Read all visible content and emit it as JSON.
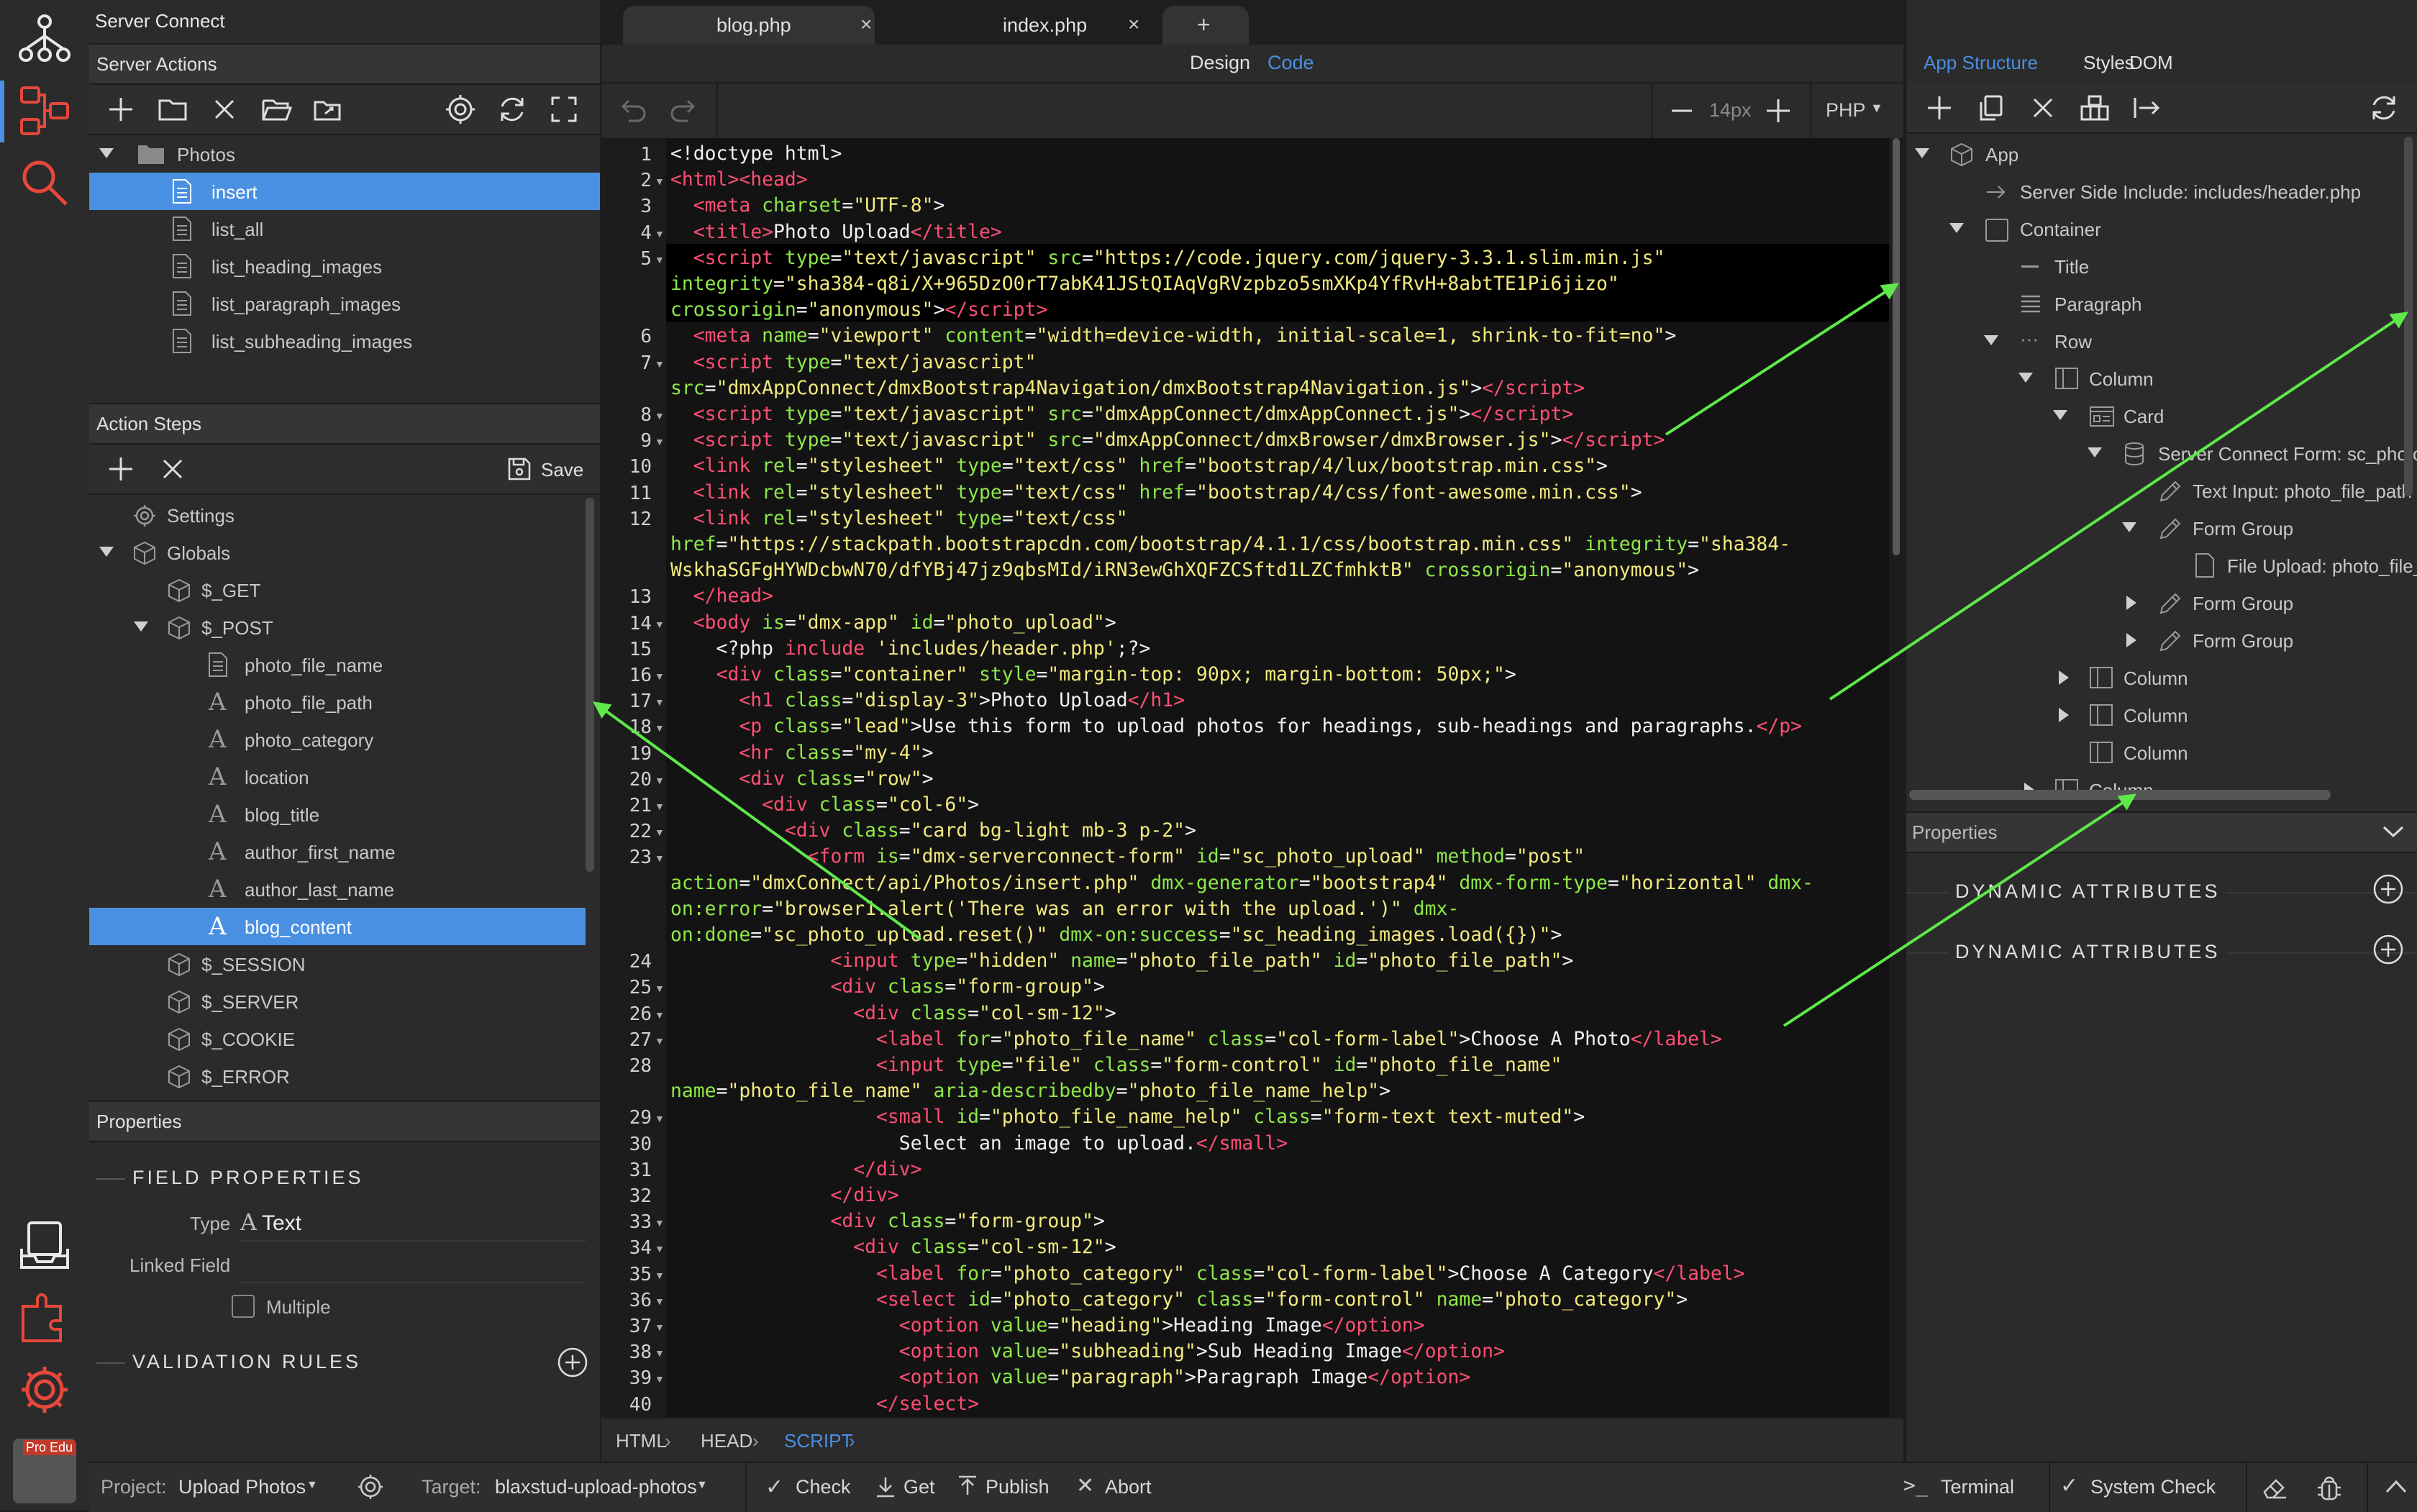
{
  "colors": {
    "accent": "#4a90e2",
    "tag": "#ff4f73",
    "attr": "#8ee84a",
    "string": "#f3e97e",
    "arrow": "#5ee84a"
  },
  "rail": {
    "badge": "Pro Edu"
  },
  "server_connect": {
    "title": "Server Connect",
    "actions_header": "Server Actions",
    "tree": [
      {
        "label": "Photos",
        "icon": "folder-icon"
      },
      {
        "label": "insert",
        "icon": "file-icon",
        "selected": true
      },
      {
        "label": "list_all",
        "icon": "file-icon"
      },
      {
        "label": "list_heading_images",
        "icon": "file-icon"
      },
      {
        "label": "list_paragraph_images",
        "icon": "file-icon"
      },
      {
        "label": "list_subheading_images",
        "icon": "file-icon"
      }
    ],
    "steps_header": "Action Steps",
    "save_label": "Save",
    "steps": [
      {
        "label": "Settings",
        "icon": "gear-icon"
      },
      {
        "label": "Globals",
        "icon": "cube-icon"
      },
      {
        "label": "$_GET",
        "icon": "cube-icon"
      },
      {
        "label": "$_POST",
        "icon": "cube-icon"
      },
      {
        "label": "photo_file_name",
        "icon": "file-icon"
      },
      {
        "label": "photo_file_path",
        "icon": "text-icon"
      },
      {
        "label": "photo_category",
        "icon": "text-icon"
      },
      {
        "label": "location",
        "icon": "text-icon"
      },
      {
        "label": "blog_title",
        "icon": "text-icon"
      },
      {
        "label": "author_first_name",
        "icon": "text-icon"
      },
      {
        "label": "author_last_name",
        "icon": "text-icon"
      },
      {
        "label": "blog_content",
        "icon": "text-icon",
        "selected": true
      },
      {
        "label": "$_SESSION",
        "icon": "cube-icon"
      },
      {
        "label": "$_SERVER",
        "icon": "cube-icon"
      },
      {
        "label": "$_COOKIE",
        "icon": "cube-icon"
      },
      {
        "label": "$_ERROR",
        "icon": "cube-icon"
      }
    ],
    "properties_header": "Properties",
    "field_properties": "FIELD PROPERTIES",
    "type_label": "Type",
    "type_value": "Text",
    "linked_field_label": "Linked Field",
    "multiple_label": "Multiple",
    "validation_rules": "VALIDATION RULES"
  },
  "editor": {
    "tabs": [
      {
        "label": "blog.php"
      },
      {
        "label": "index.php",
        "active": true
      }
    ],
    "mode_design": "Design",
    "mode_code": "Code",
    "font_size": "14px",
    "language": "PHP",
    "breadcrumb": [
      "HTML",
      "HEAD",
      "SCRIPT"
    ]
  },
  "code_lines": [
    {
      "n": "1",
      "html": "&lt;!doctype html&gt;"
    },
    {
      "n": "2",
      "fold": true,
      "html": "<span class=t>&lt;html&gt;</span><span class=t>&lt;head&gt;</span>"
    },
    {
      "n": "3",
      "html": "  <span class=t>&lt;meta</span> <span class=a>charset</span>=<span class=s>\"UTF-8\"</span>&gt;"
    },
    {
      "n": "4",
      "fold": true,
      "html": "  <span class=t>&lt;title&gt;</span>Photo Upload<span class=t>&lt;/title&gt;</span>"
    },
    {
      "n": "5",
      "fold": true,
      "html": "  <span class=t>&lt;script</span> <span class=a>type</span>=<span class=s>\"text/javascript\"</span> <span class=a>src</span>=<span class=s>\"https://code.jquery.com/jquery-3.3.1.slim.min.js\"</span>"
    },
    {
      "n": "",
      "html": "<span class=a>integrity</span>=<span class=s>\"sha384-q8i/X+965DzO0rT7abK41JStQIAqVgRVzpbzo5smXKp4YfRvH+8abtTE1Pi6jizo\"</span>"
    },
    {
      "n": "",
      "html": "<span class=a>crossorigin</span>=<span class=s>\"anonymous\"</span>&gt;<span class=t>&lt;/script&gt;</span>"
    },
    {
      "n": "6",
      "html": "  <span class=t>&lt;meta</span> <span class=a>name</span>=<span class=s>\"viewport\"</span> <span class=a>content</span>=<span class=s>\"width=device-width, initial-scale=1, shrink-to-fit=no\"</span>&gt;"
    },
    {
      "n": "7",
      "fold": true,
      "html": "  <span class=t>&lt;script</span> <span class=a>type</span>=<span class=s>\"text/javascript\"</span>"
    },
    {
      "n": "",
      "html": "<span class=a>src</span>=<span class=s>\"dmxAppConnect/dmxBootstrap4Navigation/dmxBootstrap4Navigation.js\"</span>&gt;<span class=t>&lt;/script&gt;</span>"
    },
    {
      "n": "8",
      "fold": true,
      "html": "  <span class=t>&lt;script</span> <span class=a>type</span>=<span class=s>\"text/javascript\"</span> <span class=a>src</span>=<span class=s>\"dmxAppConnect/dmxAppConnect.js\"</span>&gt;<span class=t>&lt;/script&gt;</span>"
    },
    {
      "n": "9",
      "fold": true,
      "html": "  <span class=t>&lt;script</span> <span class=a>type</span>=<span class=s>\"text/javascript\"</span> <span class=a>src</span>=<span class=s>\"dmxAppConnect/dmxBrowser/dmxBrowser.js\"</span>&gt;<span class=t>&lt;/script&gt;</span>"
    },
    {
      "n": "10",
      "html": "  <span class=t>&lt;link</span> <span class=a>rel</span>=<span class=s>\"stylesheet\"</span> <span class=a>type</span>=<span class=s>\"text/css\"</span> <span class=a>href</span>=<span class=s>\"bootstrap/4/lux/bootstrap.min.css\"</span>&gt;"
    },
    {
      "n": "11",
      "html": "  <span class=t>&lt;link</span> <span class=a>rel</span>=<span class=s>\"stylesheet\"</span> <span class=a>type</span>=<span class=s>\"text/css\"</span> <span class=a>href</span>=<span class=s>\"bootstrap/4/css/font-awesome.min.css\"</span>&gt;"
    },
    {
      "n": "12",
      "html": "  <span class=t>&lt;link</span> <span class=a>rel</span>=<span class=s>\"stylesheet\"</span> <span class=a>type</span>=<span class=s>\"text/css\"</span>"
    },
    {
      "n": "",
      "html": "<span class=a>href</span>=<span class=s>\"https://stackpath.bootstrapcdn.com/bootstrap/4.1.1/css/bootstrap.min.css\"</span> <span class=a>integrity</span>=<span class=s>\"sha384-</span>"
    },
    {
      "n": "",
      "html": "<span class=s>WskhaSGFgHYWDcbwN70/dfYBj47jz9qbsMId/iRN3ewGhXQFZCSftd1LZCfmhktB\"</span> <span class=a>crossorigin</span>=<span class=s>\"anonymous\"</span>&gt;"
    },
    {
      "n": "13",
      "html": "  <span class=t>&lt;/head&gt;</span>"
    },
    {
      "n": "14",
      "fold": true,
      "html": "  <span class=t>&lt;body</span> <span class=a>is</span>=<span class=s>\"dmx-app\"</span> <span class=a>id</span>=<span class=s>\"photo_upload\"</span>&gt;"
    },
    {
      "n": "15",
      "html": "    &lt;?php <span class=k>include</span> <span class=s>'includes/header.php'</span>;?&gt;"
    },
    {
      "n": "16",
      "fold": true,
      "html": "    <span class=t>&lt;div</span> <span class=a>class</span>=<span class=s>\"container\"</span> <span class=a>style</span>=<span class=s>\"margin-top: 90px; margin-bottom: 50px;\"</span>&gt;"
    },
    {
      "n": "17",
      "fold": true,
      "html": "      <span class=t>&lt;h1</span> <span class=a>class</span>=<span class=s>\"display-3\"</span>&gt;Photo Upload<span class=t>&lt;/h1&gt;</span>"
    },
    {
      "n": "18",
      "fold": true,
      "html": "      <span class=t>&lt;p</span> <span class=a>class</span>=<span class=s>\"lead\"</span>&gt;Use this form to upload photos for headings, sub-headings and paragraphs.<span class=t>&lt;/p&gt;</span>"
    },
    {
      "n": "19",
      "html": "      <span class=t>&lt;hr</span> <span class=a>class</span>=<span class=s>\"my-4\"</span>&gt;"
    },
    {
      "n": "20",
      "fold": true,
      "html": "      <span class=t>&lt;div</span> <span class=a>class</span>=<span class=s>\"row\"</span>&gt;"
    },
    {
      "n": "21",
      "fold": true,
      "html": "        <span class=t>&lt;div</span> <span class=a>class</span>=<span class=s>\"col-6\"</span>&gt;"
    },
    {
      "n": "22",
      "fold": true,
      "html": "          <span class=t>&lt;div</span> <span class=a>class</span>=<span class=s>\"card bg-light mb-3 p-2\"</span>&gt;"
    },
    {
      "n": "23",
      "fold": true,
      "html": "            <span class=t>&lt;form</span> <span class=a>is</span>=<span class=s>\"dmx-serverconnect-form\"</span> <span class=a>id</span>=<span class=s>\"sc_photo_upload\"</span> <span class=a>method</span>=<span class=s>\"post\"</span>"
    },
    {
      "n": "",
      "html": "<span class=a>action</span>=<span class=s>\"dmxConnect/api/Photos/insert.php\"</span> <span class=a>dmx-generator</span>=<span class=s>\"bootstrap4\"</span> <span class=a>dmx-form-type</span>=<span class=s>\"horizontal\"</span> <span class=a>dmx-</span>"
    },
    {
      "n": "",
      "html": "<span class=a>on:error</span>=<span class=s>\"browser1.alert('There was an error with the upload.')\"</span> <span class=a>dmx-</span>"
    },
    {
      "n": "",
      "html": "<span class=a>on:done</span>=<span class=s>\"sc_photo_upload.reset()\"</span> <span class=a>dmx-on:success</span>=<span class=s>\"sc_heading_images.load({})\"</span>&gt;"
    },
    {
      "n": "24",
      "html": "              <span class=t>&lt;input</span> <span class=a>type</span>=<span class=s>\"hidden\"</span> <span class=a>name</span>=<span class=s>\"photo_file_path\"</span> <span class=a>id</span>=<span class=s>\"photo_file_path\"</span>&gt;"
    },
    {
      "n": "25",
      "fold": true,
      "html": "              <span class=t>&lt;div</span> <span class=a>class</span>=<span class=s>\"form-group\"</span>&gt;"
    },
    {
      "n": "26",
      "fold": true,
      "html": "                <span class=t>&lt;div</span> <span class=a>class</span>=<span class=s>\"col-sm-12\"</span>&gt;"
    },
    {
      "n": "27",
      "fold": true,
      "html": "                  <span class=t>&lt;label</span> <span class=a>for</span>=<span class=s>\"photo_file_name\"</span> <span class=a>class</span>=<span class=s>\"col-form-label\"</span>&gt;Choose A Photo<span class=t>&lt;/label&gt;</span>"
    },
    {
      "n": "28",
      "html": "                  <span class=t>&lt;input</span> <span class=a>type</span>=<span class=s>\"file\"</span> <span class=a>class</span>=<span class=s>\"form-control\"</span> <span class=a>id</span>=<span class=s>\"photo_file_name\"</span>"
    },
    {
      "n": "",
      "html": "<span class=a>name</span>=<span class=s>\"photo_file_name\"</span> <span class=a>aria-describedby</span>=<span class=s>\"photo_file_name_help\"</span>&gt;"
    },
    {
      "n": "29",
      "fold": true,
      "html": "                  <span class=t>&lt;small</span> <span class=a>id</span>=<span class=s>\"photo_file_name_help\"</span> <span class=a>class</span>=<span class=s>\"form-text text-muted\"</span>&gt;"
    },
    {
      "n": "30",
      "html": "                    Select an image to upload.<span class=t>&lt;/small&gt;</span>"
    },
    {
      "n": "31",
      "html": "                <span class=t>&lt;/div&gt;</span>"
    },
    {
      "n": "32",
      "html": "              <span class=t>&lt;/div&gt;</span>"
    },
    {
      "n": "33",
      "fold": true,
      "html": "              <span class=t>&lt;div</span> <span class=a>class</span>=<span class=s>\"form-group\"</span>&gt;"
    },
    {
      "n": "34",
      "fold": true,
      "html": "                <span class=t>&lt;div</span> <span class=a>class</span>=<span class=s>\"col-sm-12\"</span>&gt;"
    },
    {
      "n": "35",
      "fold": true,
      "html": "                  <span class=t>&lt;label</span> <span class=a>for</span>=<span class=s>\"photo_category\"</span> <span class=a>class</span>=<span class=s>\"col-form-label\"</span>&gt;Choose A Category<span class=t>&lt;/label&gt;</span>"
    },
    {
      "n": "36",
      "fold": true,
      "html": "                  <span class=t>&lt;select</span> <span class=a>id</span>=<span class=s>\"photo_category\"</span> <span class=a>class</span>=<span class=s>\"form-control\"</span> <span class=a>name</span>=<span class=s>\"photo_category\"</span>&gt;"
    },
    {
      "n": "37",
      "fold": true,
      "html": "                    <span class=t>&lt;option</span> <span class=a>value</span>=<span class=s>\"heading\"</span>&gt;Heading Image<span class=t>&lt;/option&gt;</span>"
    },
    {
      "n": "38",
      "fold": true,
      "html": "                    <span class=t>&lt;option</span> <span class=a>value</span>=<span class=s>\"subheading\"</span>&gt;Sub Heading Image<span class=t>&lt;/option&gt;</span>"
    },
    {
      "n": "39",
      "fold": true,
      "html": "                    <span class=t>&lt;option</span> <span class=a>value</span>=<span class=s>\"paragraph\"</span>&gt;Paragraph Image<span class=t>&lt;/option&gt;</span>"
    },
    {
      "n": "40",
      "html": "                  <span class=t>&lt;/select&gt;</span>"
    }
  ],
  "app_structure": {
    "tabs": [
      "App Structure",
      "Styles",
      "DOM"
    ],
    "tree": [
      {
        "label": "App",
        "icon": "cube-icon"
      },
      {
        "label": "Server Side Include: includes/header.php",
        "icon": "include-icon"
      },
      {
        "label": "Container",
        "icon": "box-icon"
      },
      {
        "label": "Title",
        "icon": "title-icon"
      },
      {
        "label": "Paragraph",
        "icon": "paragraph-icon"
      },
      {
        "label": "Row",
        "icon": "row-icon"
      },
      {
        "label": "Column",
        "icon": "column-icon"
      },
      {
        "label": "Card",
        "icon": "card-icon"
      },
      {
        "label": "Server Connect Form: sc_photo_upload",
        "icon": "database-icon"
      },
      {
        "label": "Text Input: photo_file_path",
        "icon": "pencil-icon"
      },
      {
        "label": "Form Group",
        "icon": "pencil-icon"
      },
      {
        "label": "File Upload: photo_file_name",
        "icon": "file-icon"
      },
      {
        "label": "Form Group",
        "icon": "pencil-icon"
      },
      {
        "label": "Form Group",
        "icon": "pencil-icon"
      },
      {
        "label": "Column",
        "icon": "column-icon"
      },
      {
        "label": "Column",
        "icon": "column-icon"
      },
      {
        "label": "Column",
        "icon": "column-icon"
      },
      {
        "label": "Column",
        "icon": "column-icon"
      }
    ],
    "properties_header": "Properties",
    "dynamic_attrs": [
      "DYNAMIC ATTRIBUTES",
      "DYNAMIC ATTRIBUTES"
    ]
  },
  "status": {
    "project_label": "Project:",
    "project_value": "Upload Photos",
    "target_label": "Target:",
    "target_value": "blaxstud-upload-photos",
    "check": "Check",
    "get": "Get",
    "publish": "Publish",
    "abort": "Abort",
    "terminal": "Terminal",
    "system_check": "System Check"
  }
}
